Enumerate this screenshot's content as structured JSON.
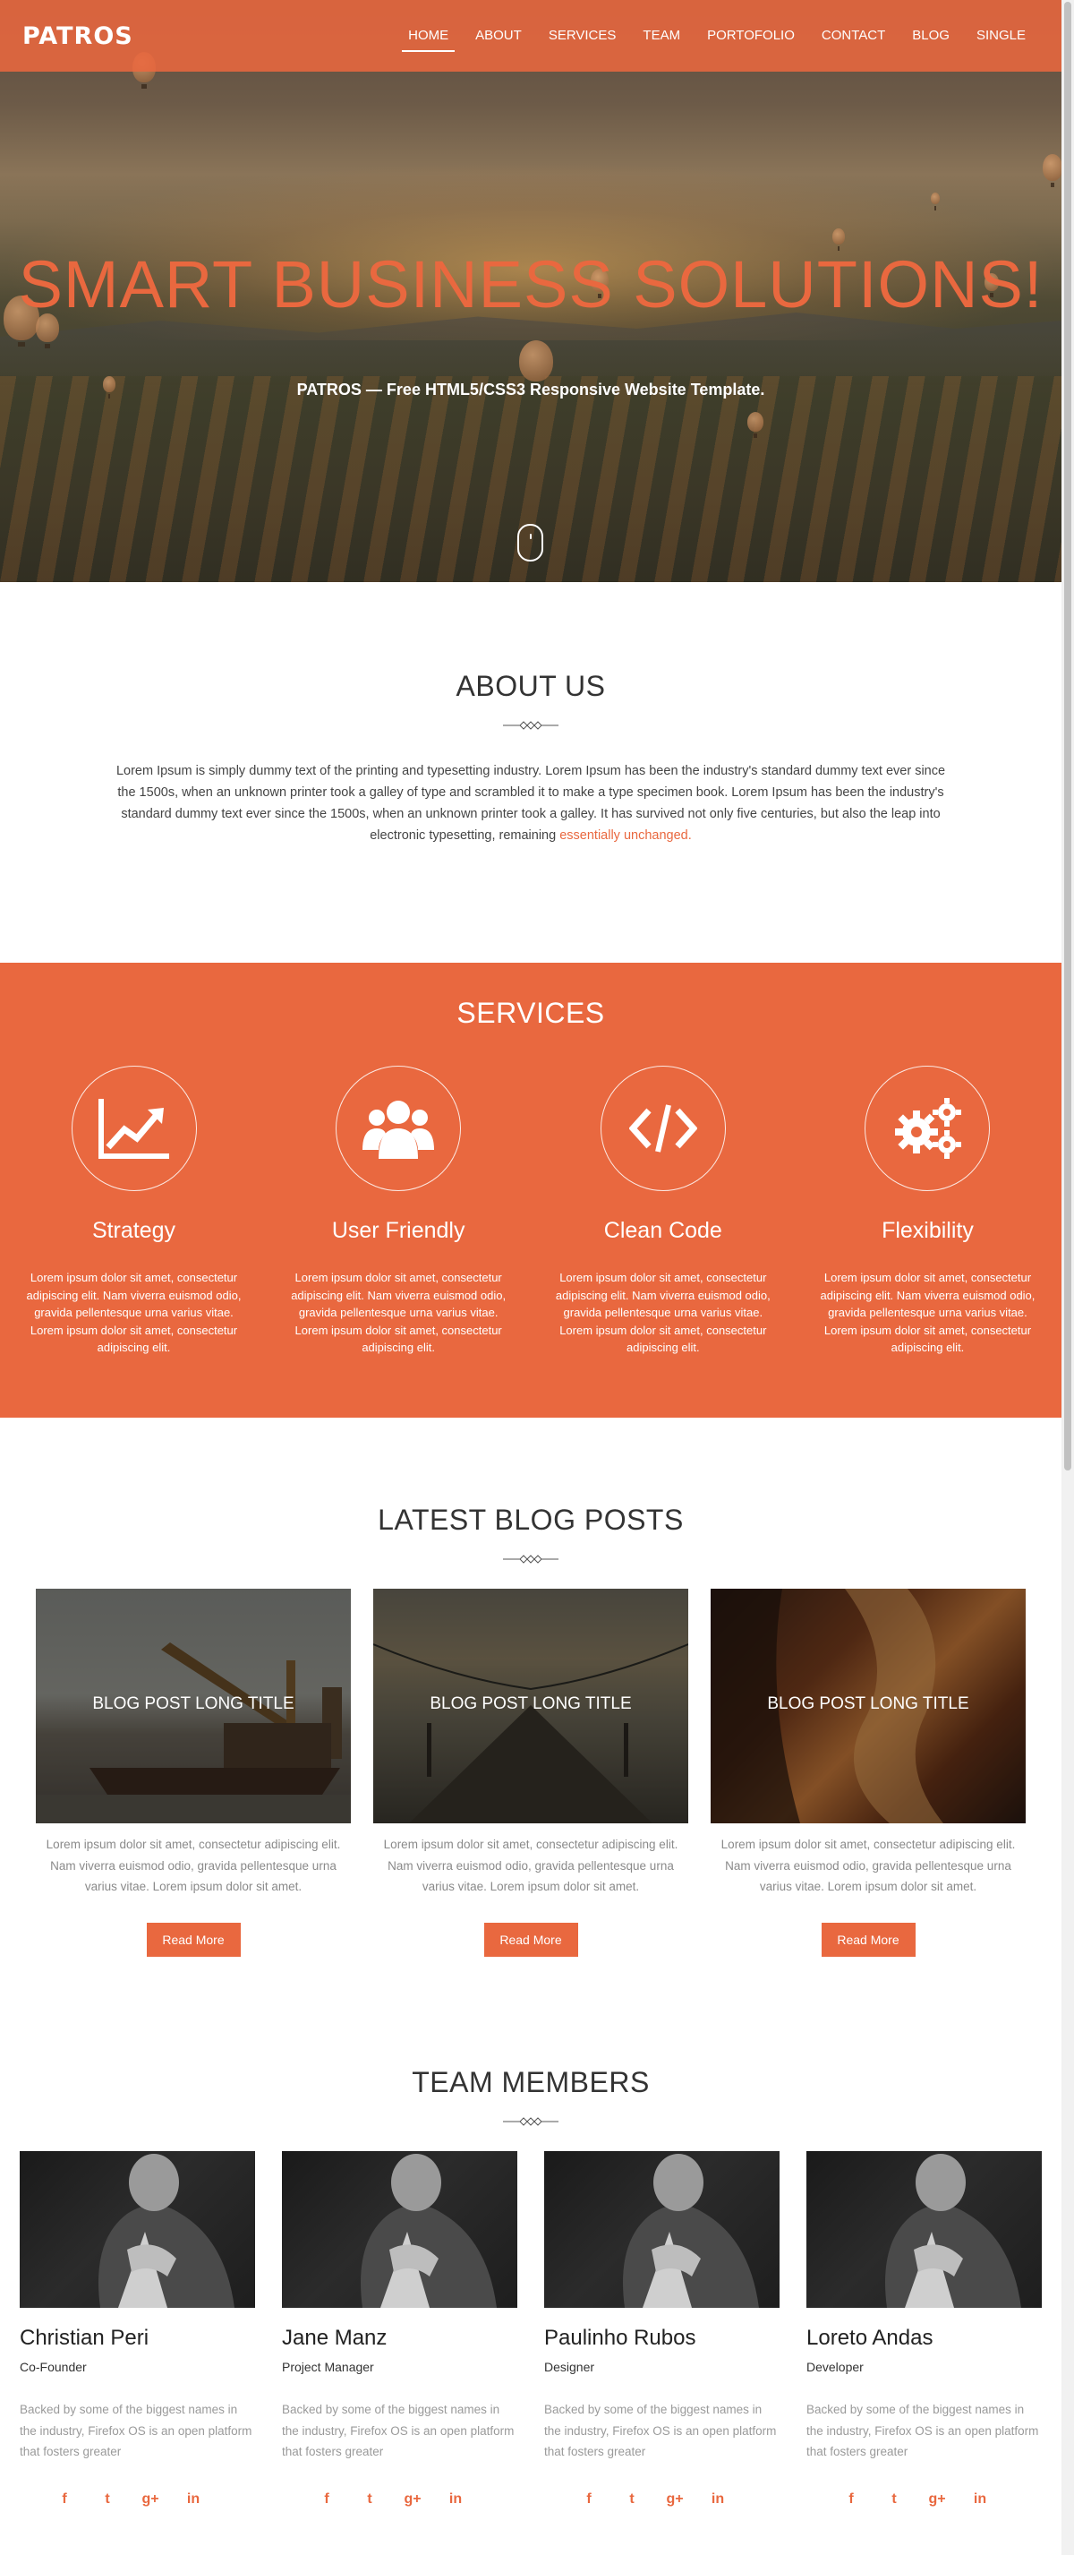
{
  "brand": {
    "logo": "PATROS",
    "accent_color": "#e9683f"
  },
  "nav": {
    "items": [
      {
        "label": "HOME",
        "active": true
      },
      {
        "label": "ABOUT",
        "active": false
      },
      {
        "label": "SERVICES",
        "active": false
      },
      {
        "label": "TEAM",
        "active": false
      },
      {
        "label": "PORTOFOLIO",
        "active": false
      },
      {
        "label": "CONTACT",
        "active": false
      },
      {
        "label": "BLOG",
        "active": false
      },
      {
        "label": "SINGLE",
        "active": false
      }
    ]
  },
  "hero": {
    "title": "SMART BUSINESS SOLUTIONS!",
    "subtitle": "PATROS — Free HTML5/CSS3 Responsive Website Template.",
    "scroll_icon": "mouse-scroll-icon"
  },
  "about": {
    "title": "ABOUT US",
    "text": "Lorem Ipsum is simply dummy text of the printing and typesetting industry. Lorem Ipsum has been the industry's standard dummy text ever since the 1500s, when an unknown printer took a galley of type and scrambled it to make a type specimen book. Lorem Ipsum has been the industry's standard dummy text ever since the 1500s, when an unknown printer took a galley. It has survived not only five centuries, but also the leap into electronic typesetting, remaining ",
    "link_text": "essentially unchanged."
  },
  "services": {
    "title": "SERVICES",
    "items": [
      {
        "icon": "line-chart-icon",
        "title": "Strategy",
        "text": "Lorem ipsum dolor sit amet, consectetur adipiscing elit. Nam viverra euismod odio, gravida pellentesque urna varius vitae. Lorem ipsum dolor sit amet, consectetur adipiscing elit."
      },
      {
        "icon": "users-icon",
        "title": "User Friendly",
        "text": "Lorem ipsum dolor sit amet, consectetur adipiscing elit. Nam viverra euismod odio, gravida pellentesque urna varius vitae. Lorem ipsum dolor sit amet, consectetur adipiscing elit."
      },
      {
        "icon": "code-icon",
        "title": "Clean Code",
        "text": "Lorem ipsum dolor sit amet, consectetur adipiscing elit. Nam viverra euismod odio, gravida pellentesque urna varius vitae. Lorem ipsum dolor sit amet, consectetur adipiscing elit."
      },
      {
        "icon": "gears-icon",
        "title": "Flexibility",
        "text": "Lorem ipsum dolor sit amet, consectetur adipiscing elit. Nam viverra euismod odio, gravida pellentesque urna varius vitae. Lorem ipsum dolor sit amet, consectetur adipiscing elit."
      }
    ]
  },
  "blog": {
    "title": "LATEST BLOG POSTS",
    "posts": [
      {
        "title": "BLOG POST LONG TITLE",
        "text": "Lorem ipsum dolor sit amet, consectetur adipiscing elit. Nam viverra euismod odio, gravida pellentesque urna varius vitae. Lorem ipsum dolor sit amet.",
        "button": "Read More"
      },
      {
        "title": "BLOG POST LONG TITLE",
        "text": "Lorem ipsum dolor sit amet, consectetur adipiscing elit. Nam viverra euismod odio, gravida pellentesque urna varius vitae. Lorem ipsum dolor sit amet.",
        "button": "Read More"
      },
      {
        "title": "BLOG POST LONG TITLE",
        "text": "Lorem ipsum dolor sit amet, consectetur adipiscing elit. Nam viverra euismod odio, gravida pellentesque urna varius vitae. Lorem ipsum dolor sit amet.",
        "button": "Read More"
      }
    ]
  },
  "team": {
    "title": "TEAM MEMBERS",
    "members": [
      {
        "name": "Christian Peri",
        "role": "Co-Founder",
        "bio": "Backed by some of the biggest names in the industry, Firefox OS is an open platform that fosters greater"
      },
      {
        "name": "Jane Manz",
        "role": "Project Manager",
        "bio": "Backed by some of the biggest names in the industry, Firefox OS is an open platform that fosters greater"
      },
      {
        "name": "Paulinho Rubos",
        "role": "Designer",
        "bio": "Backed by some of the biggest names in the industry, Firefox OS is an open platform that fosters greater"
      },
      {
        "name": "Loreto Andas",
        "role": "Developer",
        "bio": "Backed by some of the biggest names in the industry, Firefox OS is an open platform that fosters greater"
      }
    ],
    "social_icons": [
      {
        "name": "facebook-icon",
        "glyph": "f"
      },
      {
        "name": "twitter-icon",
        "glyph": "t"
      },
      {
        "name": "google-plus-icon",
        "glyph": "g+"
      },
      {
        "name": "linkedin-icon",
        "glyph": "in"
      }
    ]
  }
}
